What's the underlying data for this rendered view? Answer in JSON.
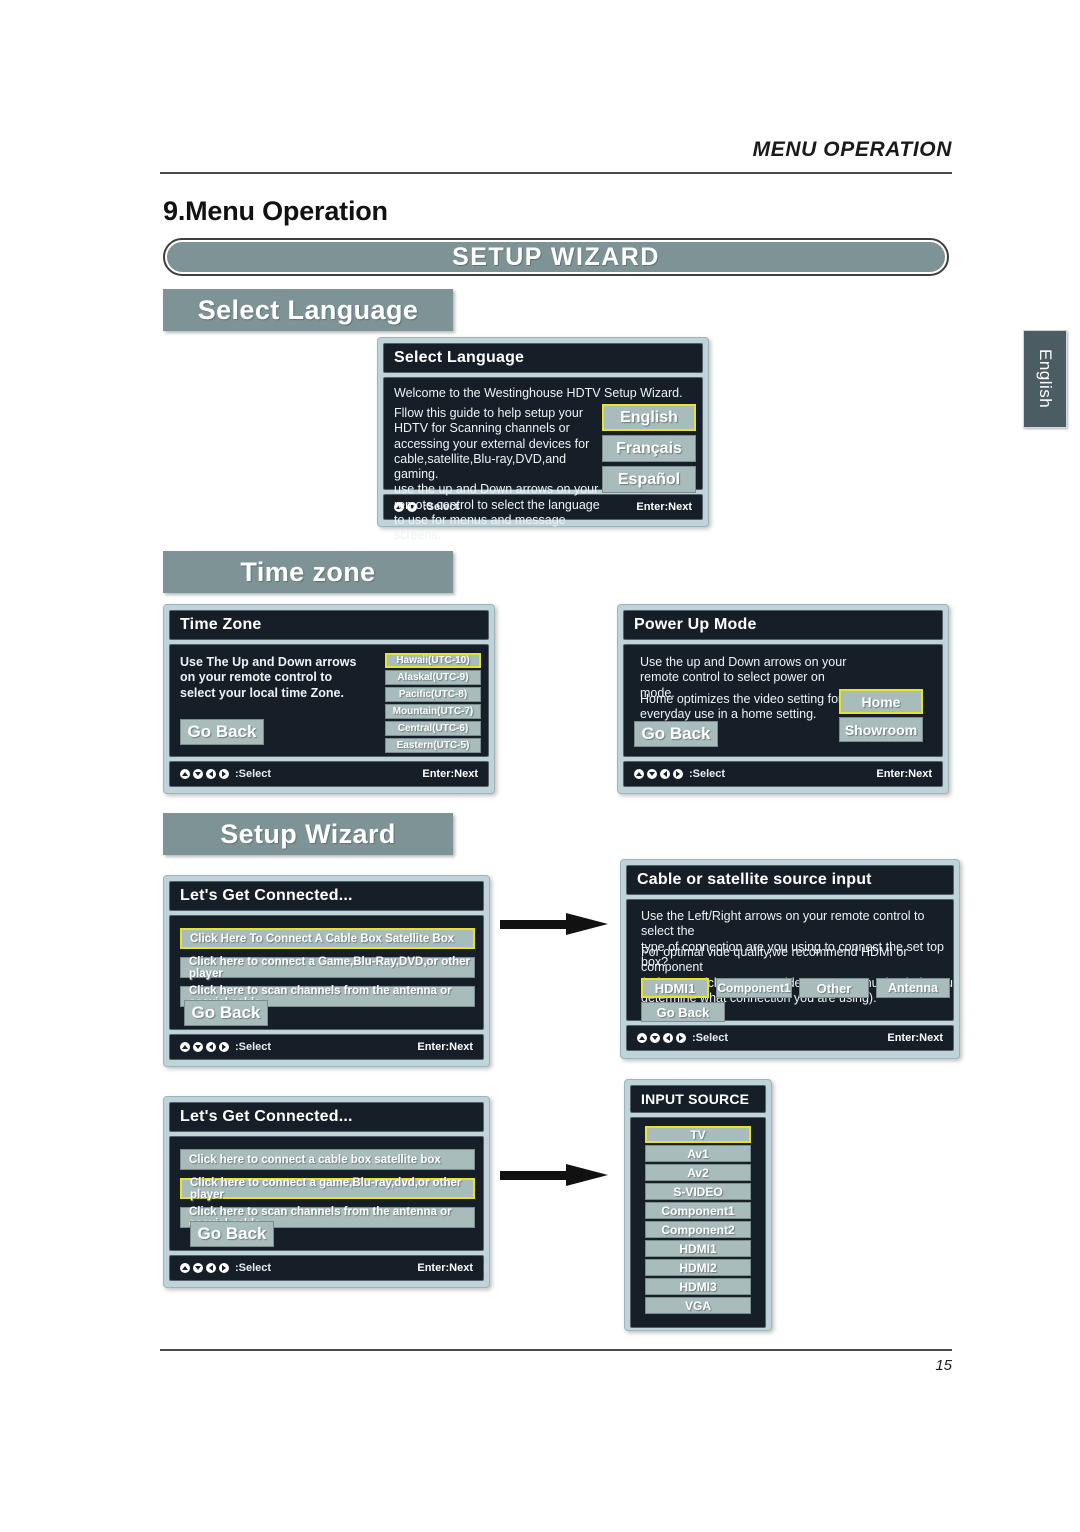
{
  "header": {
    "running_head": "MENU OPERATION",
    "chapter_number": "9.",
    "chapter_title": "Menu Operation",
    "banner": "SETUP  WIZARD",
    "language_tab": "English",
    "page_number": "15"
  },
  "sections": {
    "select_language": "Select  Language",
    "time_zone": "Time zone",
    "setup_wizard": "Setup Wizard"
  },
  "footer_hint": {
    "select": ":Select",
    "next": "Enter:Next"
  },
  "screens": {
    "select_language": {
      "title": "Select Language",
      "intro": "Welcome to the Westinghouse HDTV Setup Wizard.",
      "body_line1": "Fllow this guide to help setup your",
      "body_line2": "HDTV for Scanning channels or",
      "body_line3": "accessing your external devices for",
      "body_line4": "cable,satellite,Blu-ray,DVD,and",
      "body_line5": "gaming.",
      "body_line6": "use the up and Down arrows on your",
      "body_line7": "remote control to select the language",
      "body_line8": "to use for menus and message screens.",
      "options": [
        {
          "label": "English",
          "selected": true
        },
        {
          "label": "Français",
          "selected": false
        },
        {
          "label": "Español",
          "selected": false
        }
      ]
    },
    "time_zone": {
      "title": "Time Zone",
      "body_line1": "Use The Up and Down arrows",
      "body_line2": "on your remote control to",
      "body_line3": "select your local time Zone.",
      "go_back": "Go Back",
      "options": [
        {
          "label": "Hawaii(UTC-10)",
          "selected": true
        },
        {
          "label": "Alaskal(UTC-9)",
          "selected": false
        },
        {
          "label": "Pacific(UTC-8)",
          "selected": false
        },
        {
          "label": "Mountain(UTC-7)",
          "selected": false
        },
        {
          "label": "Central(UTC-6)",
          "selected": false
        },
        {
          "label": "Eastern(UTC-5)",
          "selected": false
        }
      ]
    },
    "power_up_mode": {
      "title": "Power Up Mode",
      "body_line1": "Use the up and Down arrows on your",
      "body_line2": "remote control to select power on mode.",
      "body_line3": "Home optimizes the video setting for",
      "body_line4": "everyday use in a home setting.",
      "go_back": "Go Back",
      "options": [
        {
          "label": "Home",
          "selected": true
        },
        {
          "label": "Showroom",
          "selected": false
        }
      ]
    },
    "lets_get_connected_1": {
      "title": "Let's Get Connected...",
      "go_back": "Go Back",
      "options": [
        {
          "label": "Click Here To Connect A Cable Box Satellite Box",
          "selected": true
        },
        {
          "label": "Click here to connect a Game,Blu-Ray,DVD,or other player",
          "selected": false
        },
        {
          "label": "Click here to scan channels from the antenna or coaxial cable",
          "selected": false
        }
      ]
    },
    "cable_or_satellite_source_input": {
      "title": "Cable or satellite source input",
      "body_line1": "Use the Left/Right arrows on your remote control to select the",
      "body_line2": "type of connection are you using to connect the set top box?",
      "body_line3": "For optimal vide quality,we recommend HDMI or component",
      "body_line4": "(refer to Quick connect guide or user manual to help you",
      "body_line5": "determine what connection you are using).",
      "go_back": "Go Back",
      "options": [
        {
          "label": "HDMI1",
          "selected": true
        },
        {
          "label": "Component1",
          "selected": false
        },
        {
          "label": "Other",
          "selected": false
        },
        {
          "label": "Antenna",
          "selected": false
        }
      ]
    },
    "lets_get_connected_2": {
      "title": "Let's Get Connected...",
      "go_back": "Go Back",
      "options": [
        {
          "label": "Click here to connect a cable box satellite box",
          "selected": false
        },
        {
          "label": "Click here to connect a game,Blu-ray,dvd,or other player",
          "selected": true
        },
        {
          "label": "Click here to scan channels from the antenna or coaxial cable",
          "selected": false
        }
      ]
    },
    "input_source": {
      "title": "INPUT SOURCE",
      "options": [
        {
          "label": "TV",
          "selected": true
        },
        {
          "label": "Av1",
          "selected": false
        },
        {
          "label": "Av2",
          "selected": false
        },
        {
          "label": "S-VIDEO",
          "selected": false
        },
        {
          "label": "Component1",
          "selected": false
        },
        {
          "label": "Component2",
          "selected": false
        },
        {
          "label": "HDMI1",
          "selected": false
        },
        {
          "label": "HDMI2",
          "selected": false
        },
        {
          "label": "HDMI3",
          "selected": false
        },
        {
          "label": "VGA",
          "selected": false
        }
      ]
    }
  },
  "colors": {
    "accent_grey": "#7e9396",
    "osd_frame": "#bfd4d8",
    "osd_panel": "#161e28",
    "option_fill": "#a9bcbc",
    "selection_border": "#e8e32a"
  }
}
